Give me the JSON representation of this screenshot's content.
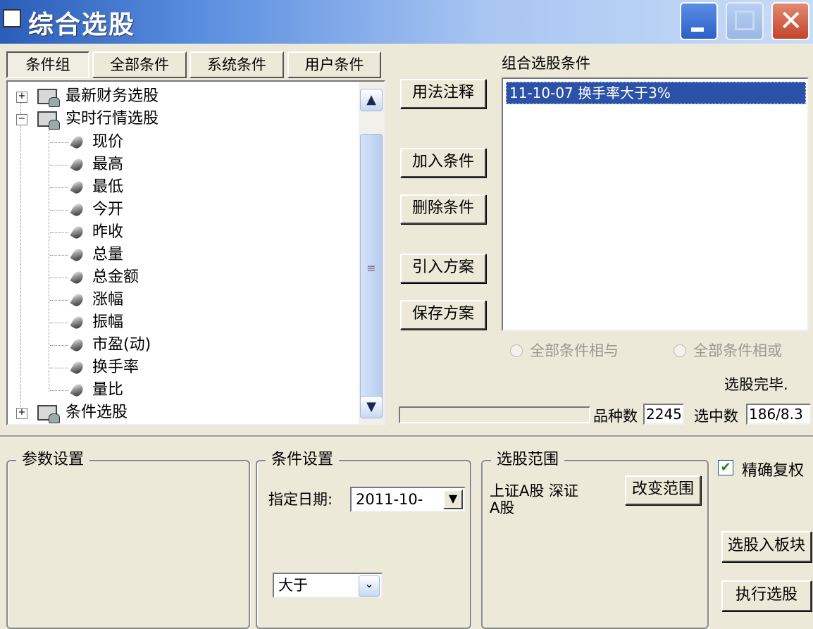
{
  "window": {
    "title": "综合选股"
  },
  "tabs": [
    "条件组",
    "全部条件",
    "系统条件",
    "用户条件"
  ],
  "tree": {
    "groups": [
      {
        "label": "最新财务选股",
        "expander": "+"
      },
      {
        "label": "实时行情选股",
        "expander": "−"
      },
      {
        "label": "条件选股",
        "expander": "+"
      }
    ],
    "items": [
      "现价",
      "最高",
      "最低",
      "今开",
      "昨收",
      "总量",
      "总金额",
      "涨幅",
      "振幅",
      "市盈(动)",
      "换手率",
      "量比"
    ]
  },
  "scroll": {
    "up": "▲",
    "down": "▼",
    "grip": "≡"
  },
  "buttons": {
    "usage_notes": "用法注释",
    "add_condition": "加入条件",
    "delete_condition": "删除条件",
    "import_plan": "引入方案",
    "save_plan": "保存方案",
    "change_range": "改变范围",
    "to_block": "选股入板块",
    "execute": "执行选股"
  },
  "combined": {
    "title": "组合选股条件",
    "items": [
      "11-10-07 换手率大于3%"
    ]
  },
  "logic": {
    "and_all": "全部条件相与",
    "or_all": "全部条件相或"
  },
  "status": {
    "text": "选股完毕.",
    "variety_label": "品种数",
    "variety_value": "2245",
    "selected_label": "选中数",
    "selected_value": "186/8.3"
  },
  "params": {
    "title": "参数设置"
  },
  "condition_settings": {
    "title": "条件设置",
    "date_label": "指定日期:",
    "date_value": "2011-10-",
    "compare_value": "大于"
  },
  "range": {
    "title": "选股范围",
    "text_line1": "上证A股 深证",
    "text_line2": "A股"
  },
  "precise_restore": {
    "label": "精确复权",
    "checked": true
  }
}
